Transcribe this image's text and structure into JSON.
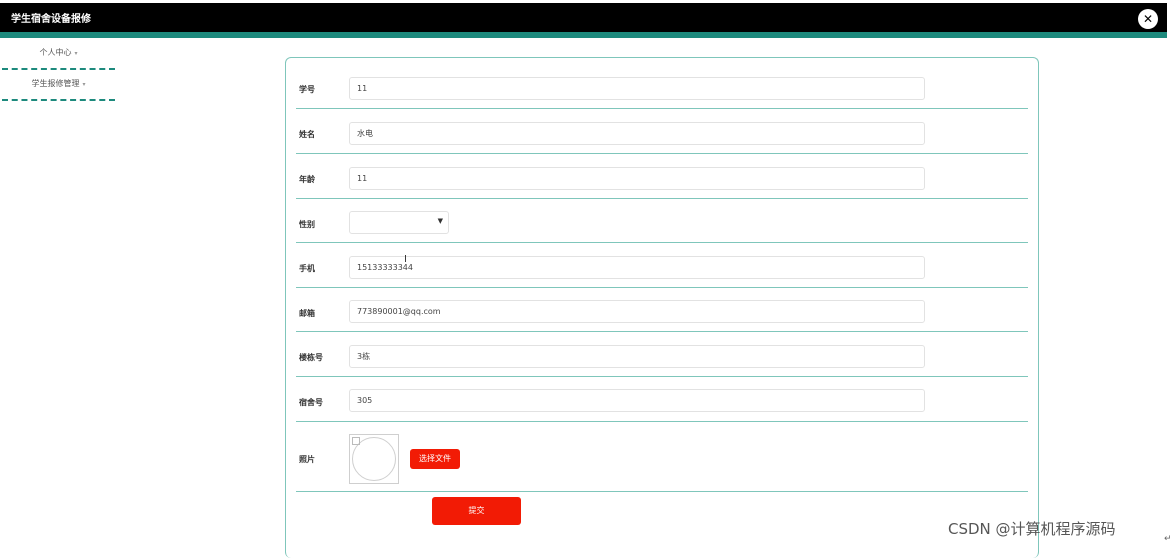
{
  "app": {
    "title": "学生宿舍设备报修",
    "close_icon": "close-icon"
  },
  "colors": {
    "header_bg": "#000000",
    "accent": "#1d8a7d",
    "button": "#f21b05",
    "row_divider": "#7fc6bb"
  },
  "sidebar": {
    "items": [
      {
        "label": "个人中心",
        "caret": "▾"
      },
      {
        "label": "学生报修管理",
        "caret": "▾"
      }
    ]
  },
  "form": {
    "fields": [
      {
        "label": "学号",
        "value": "11"
      },
      {
        "label": "姓名",
        "value": "水电"
      },
      {
        "label": "年龄",
        "value": "11"
      },
      {
        "label": "性别",
        "value": ""
      },
      {
        "label": "手机",
        "value": "15133333344"
      },
      {
        "label": "邮箱",
        "value": "773890001@qq.com"
      },
      {
        "label": "楼栋号",
        "value": "3栋"
      },
      {
        "label": "宿舍号",
        "value": "305"
      },
      {
        "label": "照片"
      }
    ],
    "file_button": "选择文件",
    "submit_button": "提交"
  },
  "watermark": "CSDN @计算机程序源码"
}
